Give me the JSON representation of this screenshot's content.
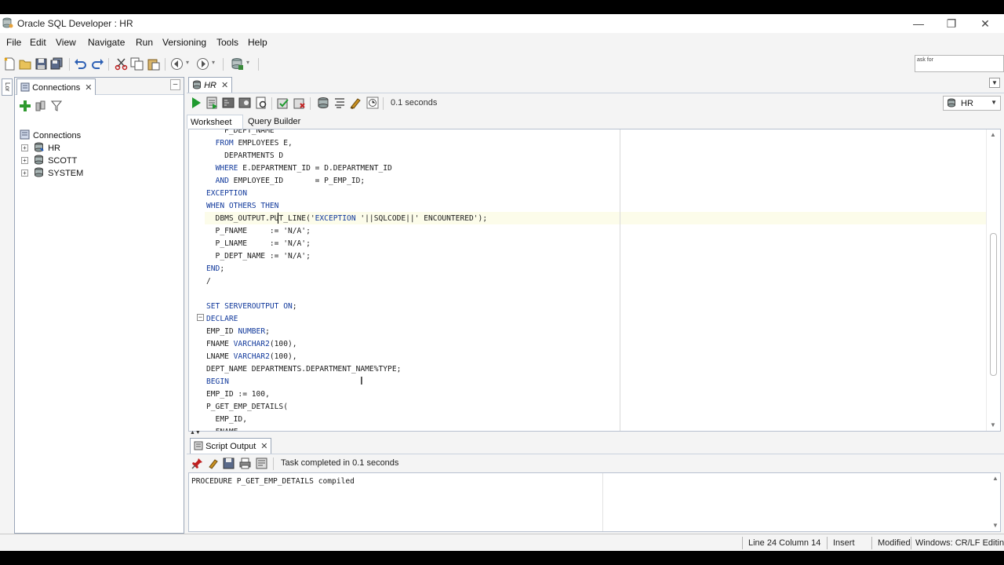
{
  "window": {
    "title": "Oracle SQL Developer : HR",
    "minimize": "—",
    "restore": "❐",
    "close": "✕"
  },
  "menu": [
    "File",
    "Edit",
    "View",
    "Navigate",
    "Run",
    "Versioning",
    "Tools",
    "Help"
  ],
  "toolbar": {
    "ask_text": "ask for"
  },
  "left_strip": {
    "tab_label": "Lor"
  },
  "connections": {
    "tab_label": "Connections",
    "tab_close": "✕",
    "minimize": "–",
    "tree_root": "Connections",
    "items": [
      "HR",
      "SCOTT",
      "SYSTEM"
    ],
    "expander": "+"
  },
  "editor": {
    "tab_label": "HR",
    "tab_close": "✕",
    "elapsed": "0.1 seconds",
    "connection": "HR",
    "subtabs": [
      "Worksheet",
      "Query Builder"
    ],
    "fold_marker": "−",
    "code_lines": [
      "    P_DEPT_NAME",
      "  FROM EMPLOYEES E,",
      "    DEPARTMENTS D",
      "  WHERE E.DEPARTMENT_ID = D.DEPARTMENT_ID",
      "  AND EMPLOYEE_ID       = P_EMP_ID;",
      "EXCEPTION",
      "WHEN OTHERS THEN",
      "  DBMS_OUTPUT.PUT_LINE('EXCEPTION '||SQLCODE||' ENCOUNTERED');",
      "  P_FNAME     := 'N/A';",
      "  P_LNAME     := 'N/A';",
      "  P_DEPT_NAME := 'N/A';",
      "END;",
      "/",
      "",
      "SET SERVEROUTPUT ON;",
      "DECLARE",
      "EMP_ID NUMBER;",
      "FNAME VARCHAR2(100),",
      "LNAME VARCHAR2(100),",
      "DEPT_NAME DEPARTMENTS.DEPARTMENT_NAME%TYPE;",
      "BEGIN",
      "EMP_ID := 100,",
      "P_GET_EMP_DETAILS(",
      "  EMP_ID,",
      "  FNAME"
    ]
  },
  "output": {
    "tab_label": "Script Output",
    "tab_close": "✕",
    "status": "Task completed in 0.1 seconds",
    "text": "PROCEDURE P_GET_EMP_DETAILS compiled"
  },
  "statusbar": {
    "position": "Line 24 Column 14",
    "mode": "Insert",
    "modified": "Modified",
    "line_endings": "Windows: CR/LF Editing"
  },
  "colors": {
    "keyword": "#123a9c",
    "panel_bg": "#f4f4f4",
    "border": "#9aa6b8",
    "run_green": "#1f9a2f"
  }
}
